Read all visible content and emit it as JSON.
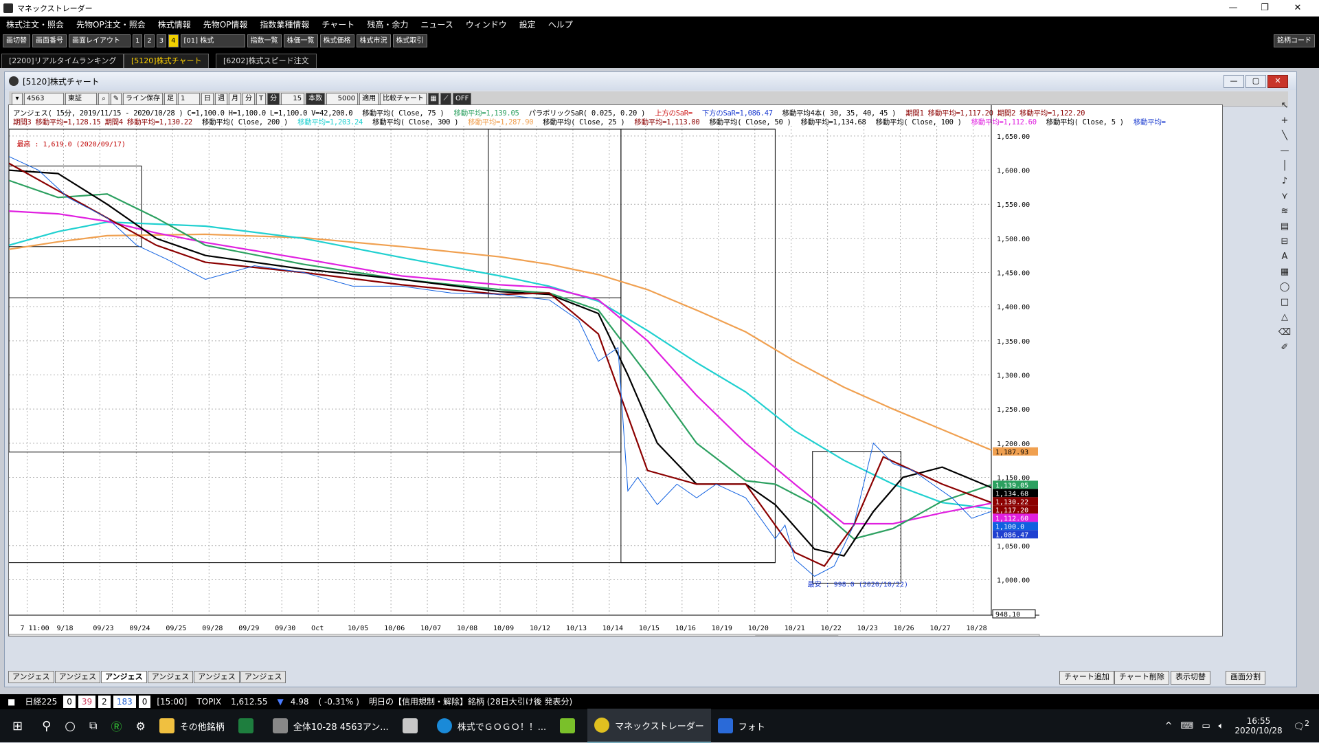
{
  "window": {
    "title": "マネックストレーダー",
    "controls": [
      "—",
      "❐",
      "✕"
    ]
  },
  "menu": [
    "株式注文・照会",
    "先物OP注文・照会",
    "株式情報",
    "先物OP情報",
    "指数業種情報",
    "チャート",
    "残高・余力",
    "ニュース",
    "ウィンドウ",
    "設定",
    "ヘルプ"
  ],
  "toolbar": {
    "switch": "画切替",
    "screen_no": "画面番号",
    "layout": "画面レイアウト",
    "pages": [
      "1",
      "2",
      "3",
      "4"
    ],
    "page_active": "4",
    "market": "[01] 株式",
    "buttons": [
      "指数一覧",
      "株価一覧",
      "株式価格",
      "株式市況",
      "株式取引"
    ],
    "right_label": "銘柄コード"
  },
  "tabs": [
    "[2200]リアルタイムランキング",
    "[5120]株式チャート",
    "[6202]株式スピード注文"
  ],
  "chart_window": {
    "title": "[5120]株式チャート",
    "controls": [
      "—",
      "▢",
      "✕"
    ],
    "toolbar": {
      "code": "4563",
      "market": "東証",
      "line_save": "ライン保存",
      "ashi": "足",
      "period_buttons": [
        "日",
        "週",
        "月",
        "分",
        "T"
      ],
      "period_active": "分",
      "minutes": "15",
      "honsu": "本数",
      "count": "5000",
      "apply": "適用",
      "compare": "比較チャート",
      "off": "OFF"
    }
  },
  "info_lines": {
    "line1": [
      {
        "text": "アンジェス( 15分, 2019/11/15 - 2020/10/28 ) C=1,100.0 H=1,100.0 L=1,100.0 V=42,200.0",
        "color": "#000000"
      },
      {
        "text": "移動平均( Close, 75 )",
        "color": "#000000"
      },
      {
        "text": "移動平均=1,139.05",
        "color": "#2ca060"
      },
      {
        "text": "パラボリックSaR( 0.025, 0.20 )",
        "color": "#000000"
      },
      {
        "text": "上方のSaR=",
        "color": "#d02020"
      },
      {
        "text": "下方のSaR=1,086.47",
        "color": "#2040d0"
      },
      {
        "text": "移動平均4本( 30, 35, 40, 45 )",
        "color": "#000000"
      },
      {
        "text": "期間1 移動平均=1,117.20 期間2 移動平均=1,122.20",
        "color": "#8b0000"
      }
    ],
    "line2": [
      {
        "text": "期間3 移動平均=1,128.15 期間4 移動平均=1,130.22",
        "color": "#8b0000"
      },
      {
        "text": "移動平均( Close, 200 )",
        "color": "#000000"
      },
      {
        "text": "移動平均=1,203.24",
        "color": "#20d0d0"
      },
      {
        "text": "移動平均( Close, 300 )",
        "color": "#000000"
      },
      {
        "text": "移動平均=1,287.90",
        "color": "#f0a050"
      },
      {
        "text": "移動平均( Close, 25 )",
        "color": "#000000"
      },
      {
        "text": "移動平均=1,113.00",
        "color": "#8b0000"
      },
      {
        "text": "移動平均( Close, 50 )",
        "color": "#000000"
      },
      {
        "text": "移動平均=1,134.68",
        "color": "#000000"
      },
      {
        "text": "移動平均( Close, 100 )",
        "color": "#000000"
      },
      {
        "text": "移動平均=1,112.60",
        "color": "#e020e0"
      },
      {
        "text": "移動平均( Close, 5 )",
        "color": "#000000"
      },
      {
        "text": "移動平均=",
        "color": "#2040d0"
      }
    ]
  },
  "annotations": {
    "high": "最高 : 1,619.0 (2020/09/17)",
    "low": "最安 : 998.0 (2020/10/22)"
  },
  "chart_data": {
    "type": "line",
    "title": "",
    "ylim": [
      948.1,
      1665
    ],
    "y_ticks": [
      1000,
      1050,
      1100,
      1150,
      1200,
      1250,
      1300,
      1350,
      1400,
      1450,
      1500,
      1550,
      1600,
      1650
    ],
    "y_tick_labels": [
      "1,000.00",
      "1,050.00",
      "1,100.00",
      "1,150.00",
      "1,200.00",
      "1,250.00",
      "1,300.00",
      "1,350.00",
      "1,400.00",
      "1,450.00",
      "1,500.00",
      "1,550.00",
      "1,600.00",
      "1,650.00"
    ],
    "y_min_label": "948.10",
    "x_tick_labels": [
      "7 11:00",
      "9/18",
      "09/23",
      "09/24",
      "09/25",
      "09/28",
      "09/29",
      "09/30",
      "Oct",
      "10/05",
      "10/06",
      "10/07",
      "10/08",
      "10/09",
      "10/12",
      "10/13",
      "10/14",
      "10/15",
      "10/16",
      "10/19",
      "10/20",
      "10/21",
      "10/22",
      "10/23",
      "10/26",
      "10/27",
      "10/28"
    ],
    "price_tags": [
      {
        "label": "1,187.93",
        "value": 1187.93,
        "color": "#f0a050"
      },
      {
        "label": "1,139.05",
        "value": 1139.05,
        "color": "#2ca060"
      },
      {
        "label": "1,134.68",
        "value": 1134.68,
        "color": "#000000"
      },
      {
        "label": "1,130.22",
        "value": 1130.22,
        "color": "#8b0000"
      },
      {
        "label": "1,117.20",
        "value": 1117.2,
        "color": "#8b0000"
      },
      {
        "label": "1,112.60",
        "value": 1112.6,
        "color": "#e020e0"
      },
      {
        "label": "1,100.0",
        "value": 1100.0,
        "color": "#1060e0"
      },
      {
        "label": "1,086.47",
        "value": 1086.47,
        "color": "#2040d0"
      }
    ],
    "series": [
      {
        "name": "移動平均( Close, 300 )",
        "color": "#f0a050",
        "x": [
          0,
          0.05,
          0.1,
          0.2,
          0.3,
          0.4,
          0.5,
          0.55,
          0.6,
          0.65,
          0.7,
          0.75,
          0.8,
          0.85,
          0.9,
          0.95,
          1.0
        ],
        "y": [
          1484,
          1495,
          1504,
          1506,
          1501,
          1488,
          1473,
          1462,
          1447,
          1425,
          1395,
          1363,
          1320,
          1282,
          1250,
          1220,
          1190
        ]
      },
      {
        "name": "移動平均( Close, 200 )",
        "color": "#20d0d0",
        "x": [
          0,
          0.05,
          0.1,
          0.2,
          0.3,
          0.4,
          0.5,
          0.55,
          0.6,
          0.65,
          0.7,
          0.75,
          0.8,
          0.85,
          0.9,
          0.95,
          1.0
        ],
        "y": [
          1490,
          1510,
          1524,
          1518,
          1500,
          1472,
          1445,
          1430,
          1408,
          1365,
          1318,
          1275,
          1218,
          1175,
          1140,
          1113,
          1104
        ]
      },
      {
        "name": "移動平均( Close, 100 )",
        "color": "#e020e0",
        "x": [
          0,
          0.05,
          0.1,
          0.15,
          0.2,
          0.3,
          0.4,
          0.5,
          0.55,
          0.6,
          0.65,
          0.7,
          0.75,
          0.8,
          0.85,
          0.9,
          0.95,
          1.0
        ],
        "y": [
          1540,
          1536,
          1525,
          1508,
          1494,
          1470,
          1445,
          1432,
          1428,
          1410,
          1350,
          1270,
          1200,
          1140,
          1082,
          1082,
          1098,
          1112
        ]
      },
      {
        "name": "移動平均( Close, 75 )",
        "color": "#2ca060",
        "x": [
          0,
          0.05,
          0.1,
          0.15,
          0.2,
          0.3,
          0.4,
          0.5,
          0.55,
          0.6,
          0.65,
          0.7,
          0.75,
          0.78,
          0.82,
          0.86,
          0.9,
          0.95,
          1.0
        ],
        "y": [
          1585,
          1560,
          1565,
          1530,
          1490,
          1462,
          1440,
          1425,
          1420,
          1395,
          1300,
          1200,
          1145,
          1140,
          1110,
          1060,
          1075,
          1115,
          1139
        ]
      },
      {
        "name": "移動平均( Close, 50 )",
        "color": "#000000",
        "x": [
          0,
          0.05,
          0.1,
          0.15,
          0.2,
          0.3,
          0.4,
          0.5,
          0.55,
          0.6,
          0.63,
          0.66,
          0.7,
          0.75,
          0.78,
          0.82,
          0.85,
          0.88,
          0.91,
          0.95,
          1.0
        ],
        "y": [
          1600,
          1595,
          1550,
          1500,
          1475,
          1455,
          1440,
          1422,
          1418,
          1390,
          1300,
          1200,
          1140,
          1140,
          1110,
          1045,
          1035,
          1100,
          1150,
          1165,
          1135
        ]
      },
      {
        "name": "移動平均( Close, 25 )",
        "color": "#8b0000",
        "x": [
          0,
          0.05,
          0.1,
          0.15,
          0.2,
          0.3,
          0.4,
          0.5,
          0.55,
          0.6,
          0.62,
          0.65,
          0.7,
          0.75,
          0.78,
          0.8,
          0.83,
          0.86,
          0.89,
          0.92,
          0.95,
          1.0
        ],
        "y": [
          1610,
          1570,
          1530,
          1490,
          1465,
          1450,
          1432,
          1418,
          1420,
          1360,
          1280,
          1160,
          1140,
          1140,
          1080,
          1040,
          1020,
          1080,
          1180,
          1160,
          1140,
          1113
        ]
      },
      {
        "name": "移動平均( Close, 5 )",
        "color": "#1060e0",
        "x": [
          0,
          0.03,
          0.06,
          0.1,
          0.13,
          0.16,
          0.2,
          0.25,
          0.3,
          0.35,
          0.4,
          0.45,
          0.5,
          0.55,
          0.58,
          0.6,
          0.62,
          0.63,
          0.64,
          0.66,
          0.68,
          0.7,
          0.72,
          0.75,
          0.78,
          0.79,
          0.8,
          0.82,
          0.84,
          0.86,
          0.88,
          0.9,
          0.92,
          0.94,
          0.96,
          0.98,
          1.0
        ],
        "y": [
          1620,
          1600,
          1560,
          1530,
          1490,
          1470,
          1440,
          1460,
          1450,
          1430,
          1430,
          1420,
          1418,
          1410,
          1380,
          1320,
          1340,
          1130,
          1150,
          1110,
          1140,
          1120,
          1140,
          1120,
          1060,
          1080,
          1030,
          1005,
          1020,
          1080,
          1200,
          1170,
          1160,
          1140,
          1120,
          1090,
          1100
        ]
      }
    ]
  },
  "stock_tabs": [
    "アンジェス",
    "アンジェス",
    "アンジェス",
    "アンジェス",
    "アンジェス",
    "アンジェス"
  ],
  "stock_tab_active": 2,
  "bottom_buttons": [
    "チャート追加",
    "チャート削除",
    "表示切替",
    "画面分割"
  ],
  "ticker": {
    "label": "日経225",
    "v1": "0",
    "v2": "39",
    "v3": "2",
    "v4": "183",
    "v5": "0",
    "time": "[15:00]",
    "index": "TOPIX",
    "price": "1,612.55",
    "change": "4.98",
    "pct": "( -0.31% )",
    "news": "明日の【信用規制・解除】銘柄 (28日大引け後 発表分)"
  },
  "taskbar": {
    "items": [
      "その他銘柄",
      "全体10-28 4563アン...",
      "株式でＧＯＧＯ！！...",
      "マネックストレーダー",
      "フォト"
    ],
    "time": "16:55",
    "date": "2020/10/28",
    "notif": "2"
  }
}
